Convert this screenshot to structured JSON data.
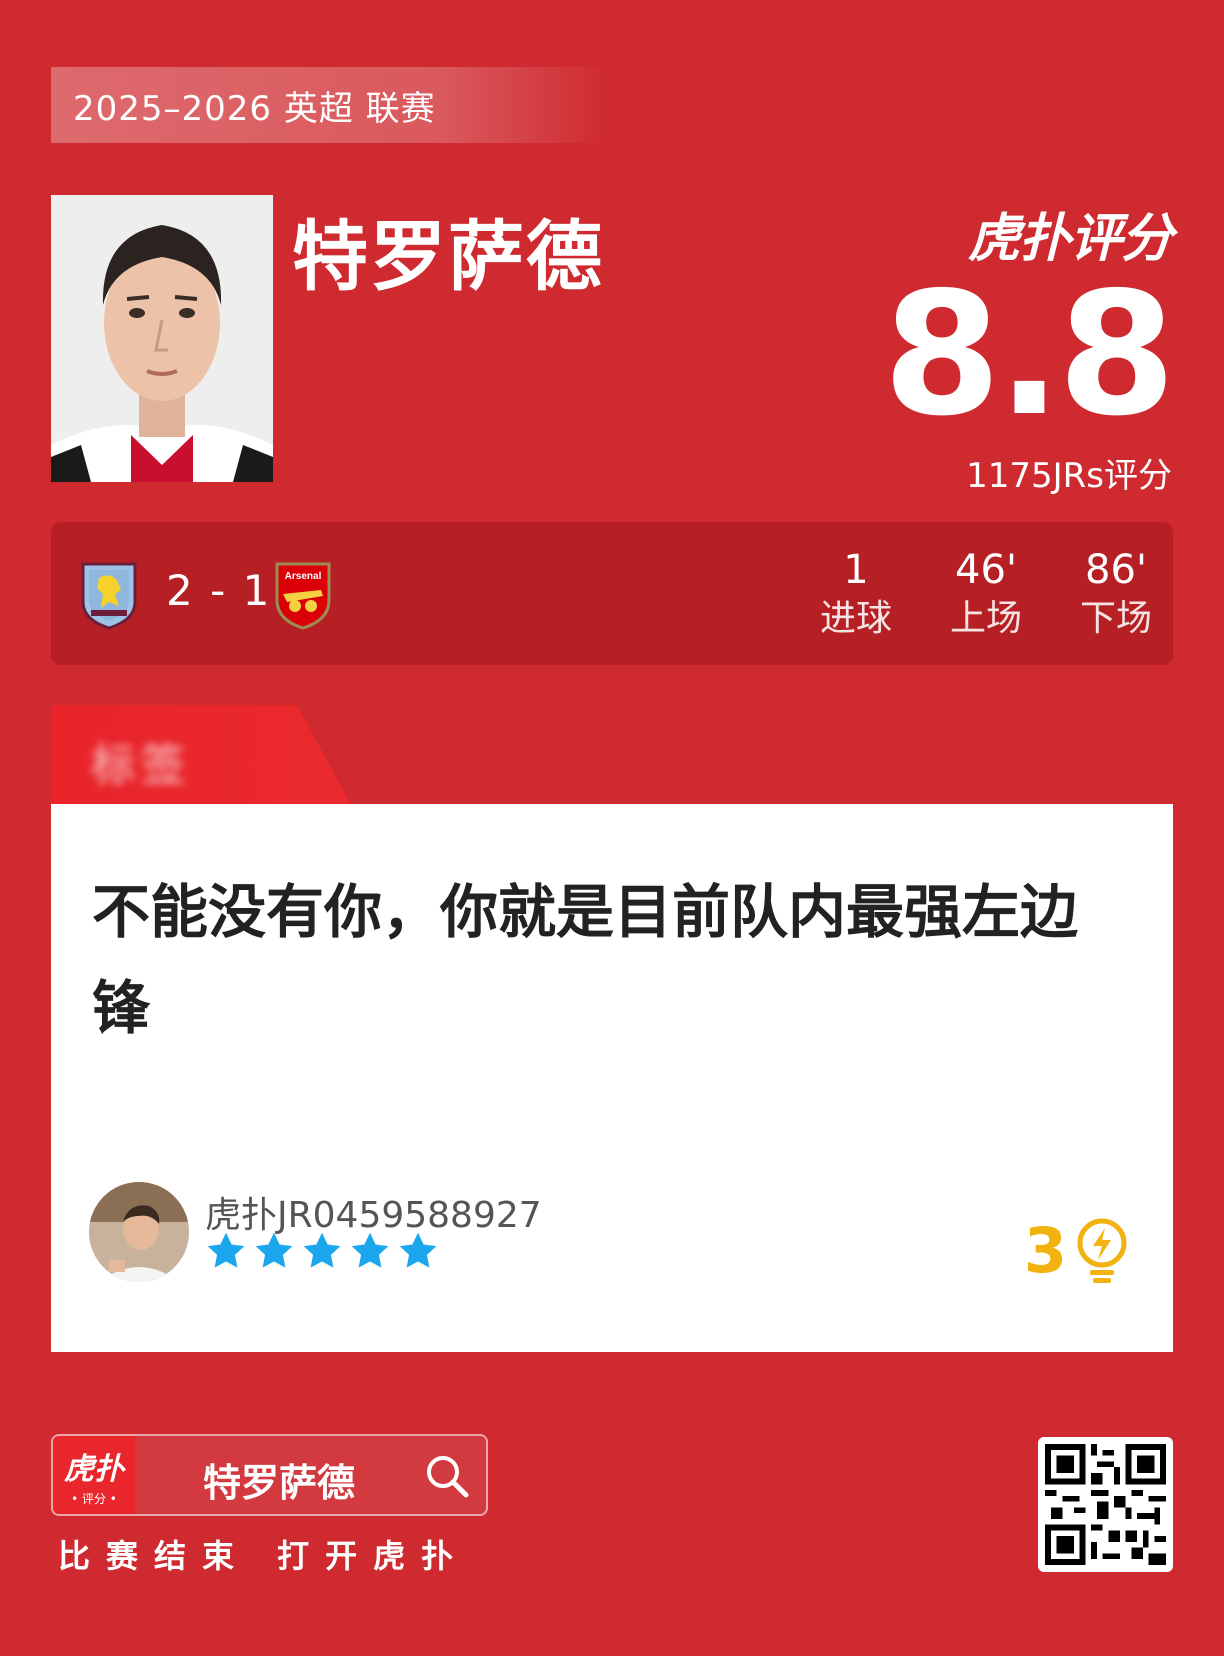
{
  "league": "2025–2026 英超 联赛",
  "player": {
    "name": "特罗萨德"
  },
  "brand": {
    "rating_title": "虎扑评分"
  },
  "rating": {
    "score": "8.8",
    "votes": "1175JRs评分"
  },
  "match": {
    "home_team": "Aston Villa",
    "away_team": "Arsenal",
    "score": "2 - 1",
    "stats": [
      {
        "value": "1",
        "label": "进球"
      },
      {
        "value": "46'",
        "label": "上场"
      },
      {
        "value": "86'",
        "label": "下场"
      }
    ]
  },
  "comment": {
    "tag": "标签",
    "text": "不能没有你，你就是目前队内最强左边锋",
    "user": "虎扑JR0459588927",
    "stars": 5,
    "likes": "3"
  },
  "footer": {
    "app_logo_main": "虎扑",
    "app_logo_sub": "• 评分 •",
    "search_text": "特罗萨德",
    "note": "比赛结束 打开虎扑"
  },
  "colors": {
    "background": "#cf2a2f",
    "match_bar": "#b62024",
    "star": "#1aa7ee",
    "likes": "#f2b20f"
  }
}
